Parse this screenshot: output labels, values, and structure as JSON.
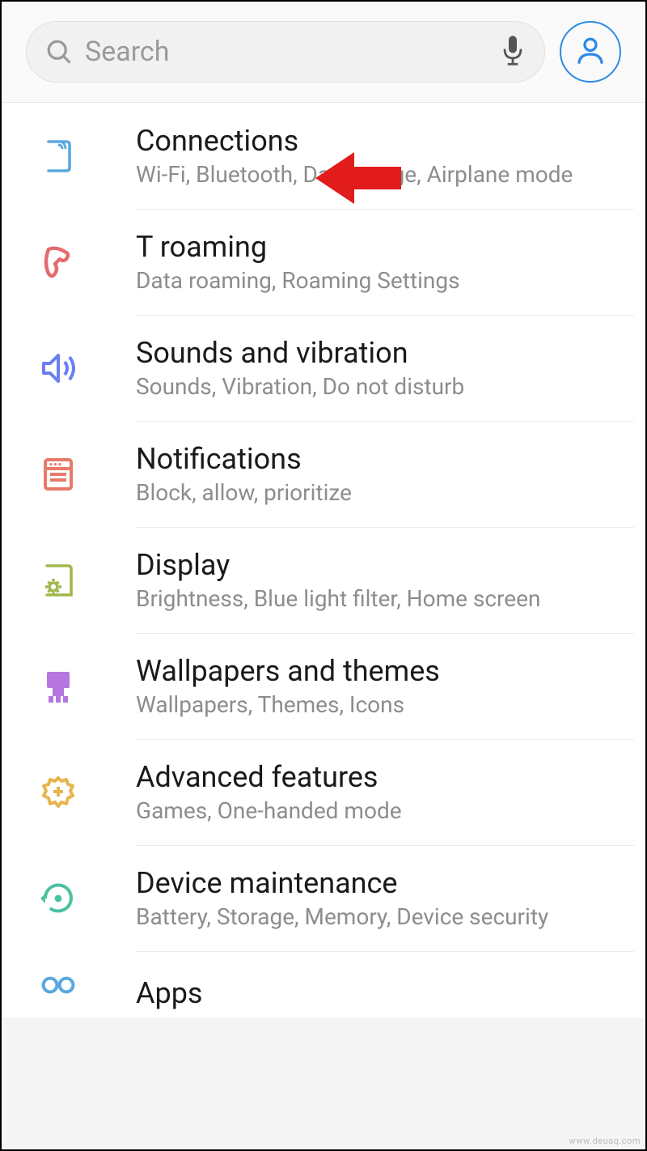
{
  "search": {
    "placeholder": "Search"
  },
  "settings": [
    {
      "title": "Connections",
      "subtitle": "Wi-Fi, Bluetooth, Data usage, Airplane mode",
      "icon": "connections",
      "color": "#5aa8e0"
    },
    {
      "title": "T roaming",
      "subtitle": "Data roaming, Roaming Settings",
      "icon": "roaming",
      "color": "#e56a6e"
    },
    {
      "title": "Sounds and vibration",
      "subtitle": "Sounds, Vibration, Do not disturb",
      "icon": "sound",
      "color": "#6b7ff0"
    },
    {
      "title": "Notifications",
      "subtitle": "Block, allow, prioritize",
      "icon": "notifications",
      "color": "#e77a6a"
    },
    {
      "title": "Display",
      "subtitle": "Brightness, Blue light filter, Home screen",
      "icon": "display",
      "color": "#a0b84e"
    },
    {
      "title": "Wallpapers and themes",
      "subtitle": "Wallpapers, Themes, Icons",
      "icon": "wallpaper",
      "color": "#b576e0"
    },
    {
      "title": "Advanced features",
      "subtitle": "Games, One-handed mode",
      "icon": "advanced",
      "color": "#e6b54c"
    },
    {
      "title": "Device maintenance",
      "subtitle": "Battery, Storage, Memory, Device security",
      "icon": "maintenance",
      "color": "#4cc0a0"
    },
    {
      "title": "Apps",
      "subtitle": "",
      "icon": "apps",
      "color": "#5aa8e0"
    }
  ],
  "watermark": "www.deuaq.com"
}
